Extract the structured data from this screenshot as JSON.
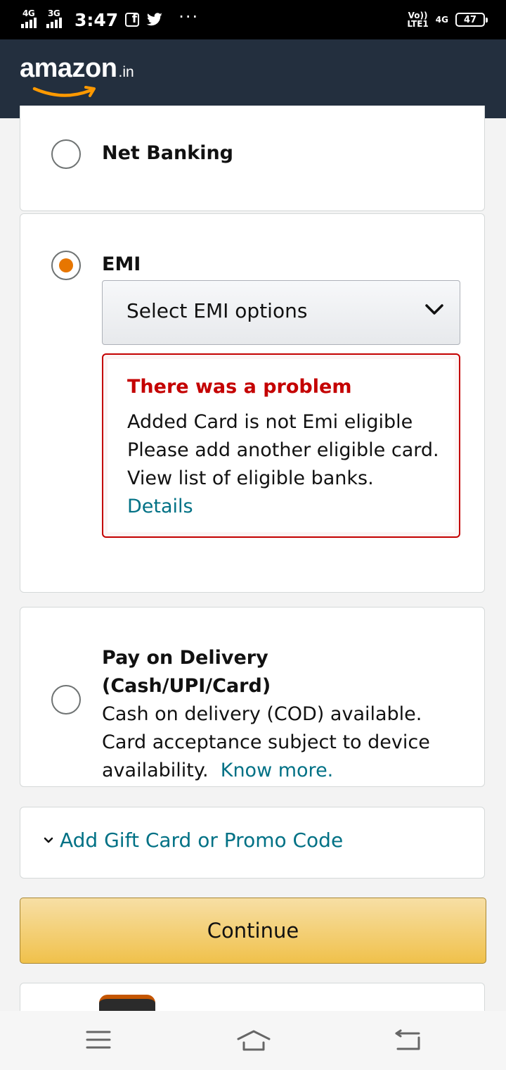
{
  "status_bar": {
    "signal_1_label": "4G",
    "signal_2_label": "3G",
    "time": "3:47",
    "overflow_dots": "···",
    "volte_label": "Vo))",
    "lte_label": "LTE1",
    "network_label": "4G",
    "battery": "47",
    "icons": [
      "facebook-icon",
      "twitter-icon"
    ]
  },
  "header": {
    "logo_text": "amazon",
    "logo_tld": ".in"
  },
  "payment_options": {
    "net_banking": {
      "label": "Net Banking",
      "selected": false
    },
    "emi": {
      "label": "EMI",
      "selected": true,
      "select_placeholder": "Select EMI options",
      "error": {
        "title": "There was a problem",
        "line1": "Added Card is not Emi eligible",
        "line2": "Please add another eligible card. View list of eligible banks.",
        "link": "Details"
      }
    },
    "pay_on_delivery": {
      "title": "Pay on Delivery (Cash/UPI/Card)",
      "description": "Cash on delivery (COD) available. Card acceptance subject to device availability.",
      "link": "Know more.",
      "selected": false
    }
  },
  "gift_card": {
    "label": "Add Gift Card or Promo Code"
  },
  "continue_button": {
    "label": "Continue"
  },
  "colors": {
    "header_bg": "#232f3e",
    "accent_orange": "#e77600",
    "link": "#007185",
    "error_red": "#c40000",
    "button_yellow": "#f0c14b"
  }
}
